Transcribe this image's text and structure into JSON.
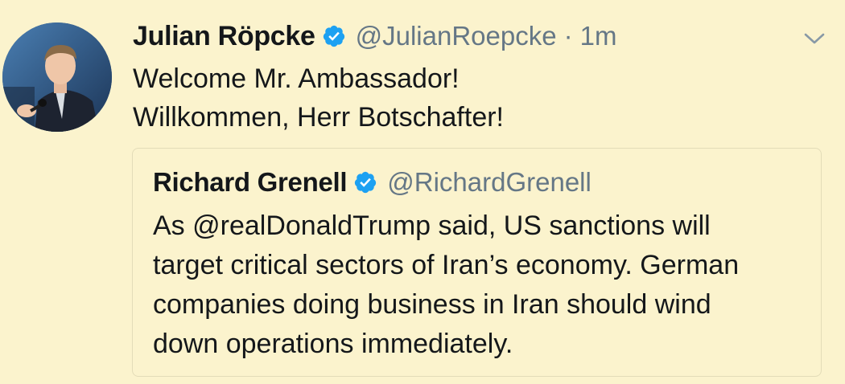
{
  "tweet": {
    "author_name": "Julian Röpcke",
    "author_handle": "@JulianRoepcke",
    "separator": "·",
    "time": "1m",
    "text_lines": [
      "Welcome Mr. Ambassador!",
      "Willkommen, Herr Botschafter!"
    ]
  },
  "quoted_tweet": {
    "author_name": "Richard Grenell",
    "author_handle": "@RichardGrenell",
    "text_lines": [
      "As @realDonaldTrump said, US sanctions will",
      "target critical sectors of Iran’s economy. German",
      "companies doing business in Iran should wind",
      "down operations immediately."
    ]
  },
  "icons": {
    "verified": "verified-badge-icon",
    "menu": "chevron-down-icon"
  },
  "colors": {
    "background": "#fbf3cd",
    "verified_blue": "#1da1f2",
    "secondary_text": "#657786",
    "primary_text": "#14171a"
  }
}
